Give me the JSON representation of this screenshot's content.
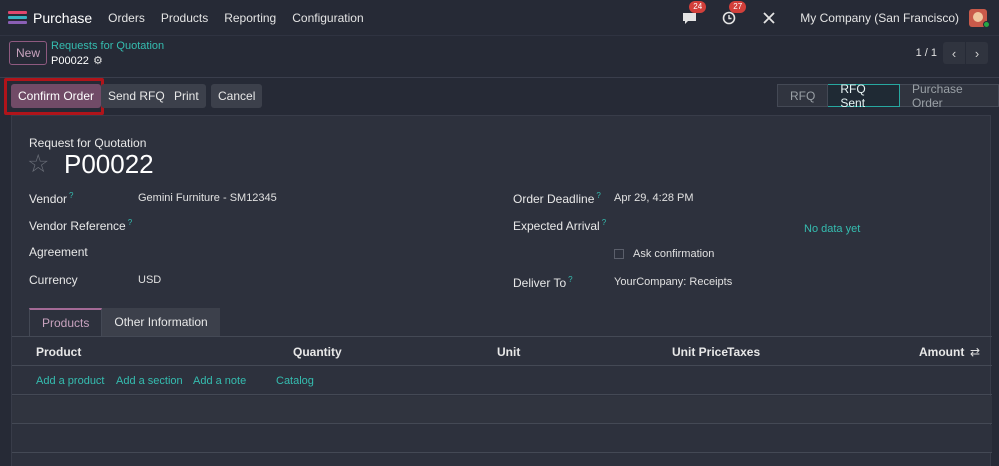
{
  "navbar": {
    "app_name": "Purchase",
    "menu": [
      "Orders",
      "Products",
      "Reporting",
      "Configuration"
    ],
    "chat_badge": "24",
    "activity_badge": "27",
    "company": "My Company (San Francisco)"
  },
  "control_panel": {
    "new_label": "New",
    "breadcrumb": "Requests for Quotation",
    "record": "P00022",
    "pager": "1 / 1"
  },
  "actions": {
    "confirm": "Confirm Order",
    "send_rfq": "Send RFQ",
    "print": "Print",
    "cancel": "Cancel"
  },
  "status": [
    "RFQ",
    "RFQ Sent",
    "Purchase Order"
  ],
  "form": {
    "sheet_label": "Request for Quotation",
    "title": "P00022",
    "vendor_label": "Vendor",
    "vendor_value": "Gemini Furniture - SM12345",
    "vendor_ref_label": "Vendor Reference",
    "agreement_label": "Agreement",
    "currency_label": "Currency",
    "currency_value": "USD",
    "deadline_label": "Order Deadline",
    "deadline_value": "Apr 29, 4:28 PM",
    "arrival_label": "Expected Arrival",
    "no_data": "No data yet",
    "ask_confirmation": "Ask confirmation",
    "deliver_label": "Deliver To",
    "deliver_value": "YourCompany: Receipts",
    "help_mark": "?"
  },
  "tabs": [
    "Products",
    "Other Information"
  ],
  "table": {
    "columns": [
      "Product",
      "Quantity",
      "Unit",
      "Unit Price",
      "Taxes",
      "Amount"
    ],
    "add_product": "Add a product",
    "add_section": "Add a section",
    "add_note": "Add a note",
    "catalog": "Catalog"
  },
  "colors": {
    "primary": "#714b67",
    "accent": "#35bdb0",
    "badge": "#d23f3a"
  }
}
